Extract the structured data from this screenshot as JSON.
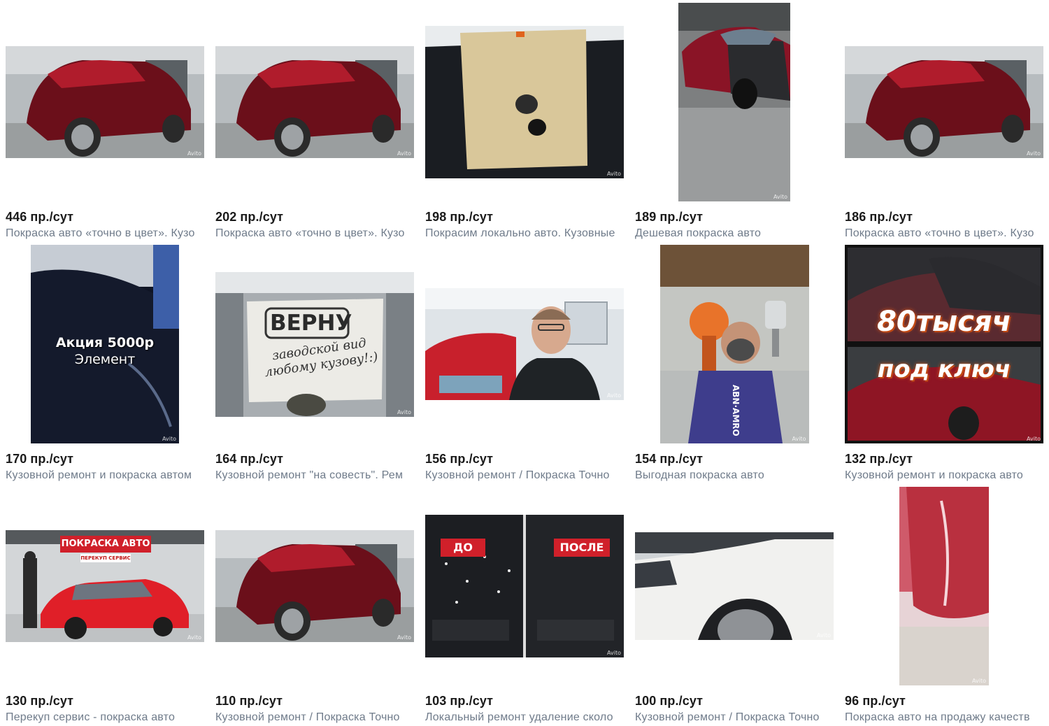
{
  "cards": [
    {
      "views": "446 пр./сут",
      "title": "Покраска авто «точно в цвет». Кузо"
    },
    {
      "views": "202 пр./сут",
      "title": "Покраска авто «точно в цвет». Кузо"
    },
    {
      "views": "198 пр./сут",
      "title": "Покрасим локально авто. Кузовные"
    },
    {
      "views": "189 пр./сут",
      "title": "Дешевая покраска авто"
    },
    {
      "views": "186 пр./сут",
      "title": "Покраска авто «точно в цвет». Кузо"
    },
    {
      "views": "170 пр./сут",
      "title": "Кузовной ремонт и покраска автом"
    },
    {
      "views": "164 пр./сут",
      "title": "Кузовной ремонт \"на совесть\". Рем"
    },
    {
      "views": "156 пр./сут",
      "title": "Кузовной ремонт / Покраска Точно"
    },
    {
      "views": "154 пр./сут",
      "title": "Выгодная покраска авто"
    },
    {
      "views": "132 пр./сут",
      "title": "Кузовной ремонт и покраска авто"
    },
    {
      "views": "130 пр./сут",
      "title": "Перекуп сервис - покраска авто"
    },
    {
      "views": "110 пр./сут",
      "title": "Кузовной ремонт / Покраска Точно"
    },
    {
      "views": "103 пр./сут",
      "title": "Локальный ремонт удаление сколо"
    },
    {
      "views": "100 пр./сут",
      "title": "Кузовной ремонт / Покраска Точно"
    },
    {
      "views": "96 пр./сут",
      "title": "Покраска авто на продажу качеств"
    }
  ],
  "overlays": {
    "promo_line1": "Акция 5000р",
    "promo_line2": "Элемент",
    "sign_big": "ВЕРНУ",
    "sign_small1": "заводской вид",
    "sign_small2": "любому кузову!:)",
    "price_top": "80тысяч",
    "price_bottom": "под ключ",
    "banner_title": "ПОКРАСКА АВТО",
    "banner_sub": "ПЕРЕКУП СЕРВИС",
    "before": "ДО",
    "after": "ПОСЛЕ",
    "jersey": "ABN·AMRO",
    "watermark": "Avito"
  },
  "colors": {
    "views_text": "#1a1a1a",
    "title_text": "#6f7b8a",
    "accent_red": "#d0202a"
  }
}
